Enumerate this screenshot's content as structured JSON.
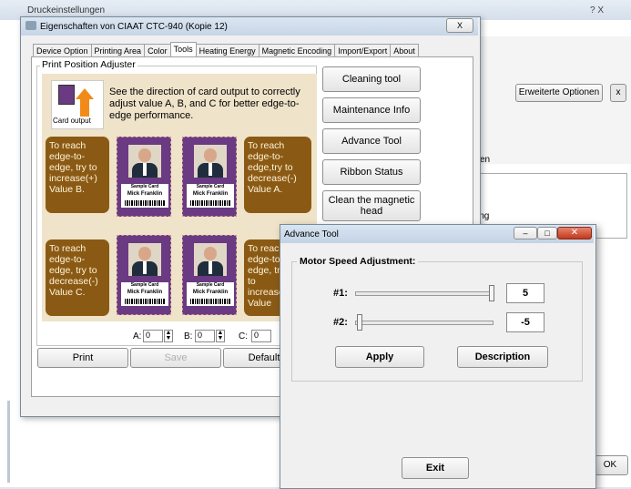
{
  "bg_window": {
    "title": "Druckeinstellungen"
  },
  "bg_right": {
    "advanced_options_label": "Erweiterte Optionen",
    "close_label": "x",
    "text_line1": "en",
    "text_line2": "ing",
    "ok_label": "OK",
    "title_controls": "? X"
  },
  "props": {
    "title": "Eigenschaften von CIAAT CTC-940 (Kopie 12)",
    "close_label": "X",
    "tabs": [
      "Device Option",
      "Printing Area",
      "Color",
      "Tools",
      "Heating Energy",
      "Magnetic Encoding",
      "Import/Export",
      "About"
    ],
    "adjuster": {
      "group_label": "Print Position Adjuster",
      "card_output_label": "Card output",
      "instructions": "See the direction of card output to correctly adjust value A, B, and C for better edge-to-edge performance.",
      "bubble_tl": "To reach edge-to-edge, try to increase(+) Value B.",
      "bubble_tr": "To reach edge-to-edge,try to decrease(-) Value A.",
      "bubble_bl": "To reach edge-to-edge, try to decrease(-) Value C.",
      "bubble_br": "To reach edge-to-edge, try to increase(+) Value",
      "card_name": "Mick Franklin",
      "card_sub": "Sample Card",
      "a_label": "A:",
      "a_value": "0",
      "b_label": "B:",
      "b_value": "0",
      "c_label": "C:",
      "c_value": "0"
    },
    "tools": {
      "cleaning": "Cleaning tool",
      "maintenance": "Maintenance Info",
      "advance": "Advance Tool",
      "ribbon": "Ribbon Status",
      "clean_magnetic": "Clean the magnetic head"
    },
    "bottom": {
      "print": "Print",
      "save": "Save",
      "default": "Default"
    }
  },
  "advance": {
    "title": "Advance Tool",
    "group_label": "Motor Speed Adjustment:",
    "m1_label": "#1:",
    "m1_value": "5",
    "m2_label": "#2:",
    "m2_value": "-5",
    "apply": "Apply",
    "description": "Description",
    "exit": "Exit"
  },
  "colors": {
    "accent_orange": "#8a5a15",
    "card_purple": "#6a3a82"
  }
}
